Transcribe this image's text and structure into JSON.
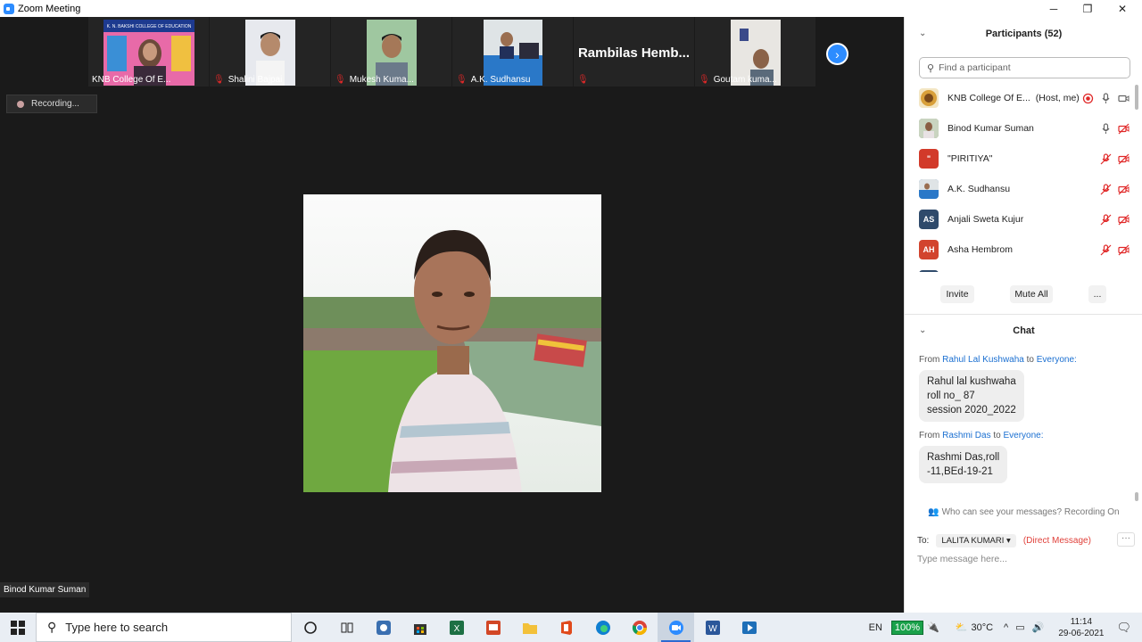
{
  "window": {
    "title": "Zoom Meeting",
    "controls": {
      "minimize": "─",
      "maximize": "❐",
      "close": "✕"
    }
  },
  "thumbnails": [
    {
      "name": "KNB College Of E...",
      "muted": false,
      "kind": "banner",
      "banner_text": "K. N. BAKSHI COLLEGE OF EDUCATION"
    },
    {
      "name": "Shalini Bajpai",
      "muted": true,
      "kind": "person"
    },
    {
      "name": "Mukesh Kuma...",
      "muted": true,
      "kind": "person"
    },
    {
      "name": "A.K. Sudhansu",
      "muted": true,
      "kind": "person"
    },
    {
      "name": "",
      "display_name": "Rambilas  Hemb...",
      "muted": true,
      "kind": "name-only"
    },
    {
      "name": "Goutam kuma...",
      "muted": true,
      "kind": "person"
    }
  ],
  "next_page_icon": "chevron-right-icon",
  "recording_badge": "Recording...",
  "active_speaker": "Binod Kumar Suman",
  "participants": {
    "header": "Participants (52)",
    "search_placeholder": "Find a participant",
    "list": [
      {
        "name": "KNB College Of E...",
        "tag": "(Host, me)",
        "avatar_text": "",
        "avatar_color": "#f3e6c4",
        "mic": "on",
        "video": "on",
        "recording": true
      },
      {
        "name": "Binod Kumar Suman",
        "tag": "",
        "avatar_text": "",
        "avatar_color": "#7a8a6a",
        "mic": "on",
        "video": "off",
        "recording": false
      },
      {
        "name": "\"PIRITIYA\"",
        "tag": "",
        "avatar_text": "\"",
        "avatar_color": "#d23a2a",
        "mic": "off",
        "video": "off",
        "recording": false
      },
      {
        "name": "A.K. Sudhansu",
        "tag": "",
        "avatar_text": "",
        "avatar_color": "#3a6fb0",
        "mic": "off",
        "video": "off",
        "recording": false
      },
      {
        "name": "Anjali Sweta Kujur",
        "tag": "",
        "avatar_text": "AS",
        "avatar_color": "#2f4a6b",
        "mic": "off",
        "video": "off",
        "recording": false
      },
      {
        "name": "Asha Hembrom",
        "tag": "",
        "avatar_text": "AH",
        "avatar_color": "#d2442e",
        "mic": "off",
        "video": "off",
        "recording": false
      }
    ],
    "buttons": {
      "invite": "Invite",
      "mute_all": "Mute All",
      "more": "..."
    }
  },
  "chat": {
    "header": "Chat",
    "messages": [
      {
        "from_label": "From",
        "sender": "Rahul Lal Kushwaha",
        "to_label": "to",
        "recipient": "Everyone:",
        "lines": [
          "Rahul lal kushwaha",
          "roll no_ 87",
          "session 2020_2022"
        ]
      },
      {
        "from_label": "From",
        "sender": "Rashmi Das",
        "to_label": "to",
        "recipient": "Everyone:",
        "lines": [
          "Rashmi Das,roll",
          "-11,BEd-19-21"
        ]
      }
    ],
    "who_can_see": "Who can see your messages? Recording On",
    "to_label": "To:",
    "to_value": "LALITA KUMARI",
    "direct_message": "(Direct Message)",
    "more": "···",
    "input_placeholder": "Type message here..."
  },
  "taskbar": {
    "search_placeholder": "Type here to search",
    "apps": [
      "cortana-icon",
      "task-view-icon",
      "app-icon",
      "store-icon",
      "excel-icon",
      "impress-icon",
      "file-explorer-icon",
      "office-icon",
      "edge-icon",
      "chrome-icon",
      "zoom-icon",
      "word-icon",
      "media-player-icon"
    ],
    "active_app": "zoom-icon",
    "language": "EN",
    "battery": "100%",
    "temperature": "30°C",
    "time": "11:14",
    "date": "29-06-2021"
  }
}
